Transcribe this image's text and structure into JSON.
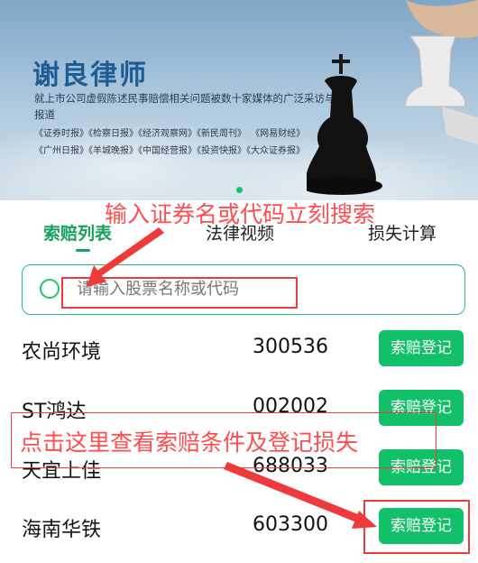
{
  "banner": {
    "title": "谢良律师",
    "description": "就上市公司虚假陈述民事赔偿相关问题被数十家媒体的广泛采访与报道",
    "media_line1": "《证券时报》《检察日报》《经济观察网》《新民周刊》  《网易财经》",
    "media_line2": "《广州日报》《羊城晚报》《中国经营报》《投资快报》《大众证券报》"
  },
  "tabs": [
    {
      "label": "索赔列表",
      "active": true
    },
    {
      "label": "法律视频",
      "active": false
    },
    {
      "label": "损失计算",
      "active": false
    }
  ],
  "search": {
    "placeholder": "请输入股票名称或代码"
  },
  "stocks": [
    {
      "name": "农尚环境",
      "code": "300536",
      "button": "索赔登记"
    },
    {
      "name": "ST鸿达",
      "code": "002002",
      "button": "索赔登记"
    },
    {
      "name": "天宜上佳",
      "code": "688033",
      "button": "索赔登记"
    },
    {
      "name": "海南华铁",
      "code": "603300",
      "button": "索赔登记"
    }
  ],
  "annotations": {
    "search_hint": "输入证券名或代码立刻搜索",
    "register_hint": "点击这里查看索赔条件及登记损失"
  },
  "colors": {
    "accent": "#1aa15b",
    "button": "#13c06a",
    "annotation": "#ff4d4f",
    "banner_title": "#1d5d92"
  }
}
